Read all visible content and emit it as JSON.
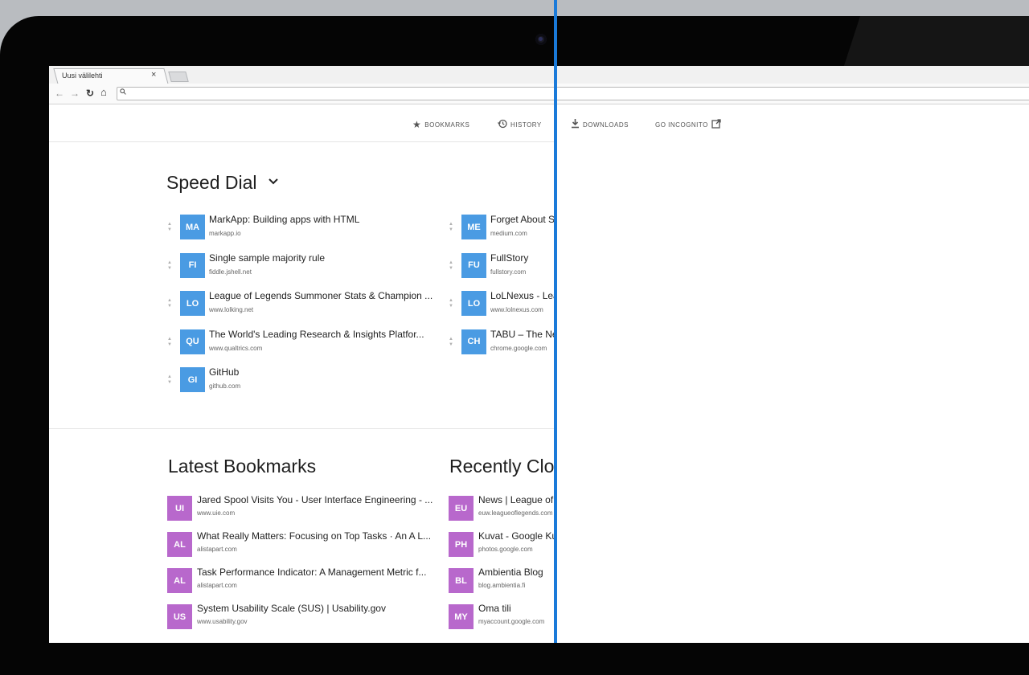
{
  "browser": {
    "tab_title": "Uusi välilehti",
    "tab_close": "×",
    "back_icon": "←",
    "forward_icon": "→",
    "reload_icon": "↻",
    "home_icon": "⌂"
  },
  "topnav": {
    "bookmarks": "BOOKMARKS",
    "history": "HISTORY",
    "downloads": "DOWNLOADS",
    "incognito": "GO INCOGNITO"
  },
  "speed_dial": {
    "title": "Speed Dial",
    "tile_color": "#4a9be3",
    "left": [
      {
        "abbr": "MA",
        "title": "MarkApp: Building apps with HTML",
        "url": "markapp.io"
      },
      {
        "abbr": "FI",
        "title": "Single sample majority rule",
        "url": "fiddle.jshell.net"
      },
      {
        "abbr": "LO",
        "title": "League of Legends Summoner Stats & Champion ...",
        "url": "www.lolking.net"
      },
      {
        "abbr": "QU",
        "title": "The World's Leading Research & Insights Platfor...",
        "url": "www.qualtrics.com"
      },
      {
        "abbr": "GI",
        "title": "GitHub",
        "url": "github.com"
      }
    ],
    "right": [
      {
        "abbr": "ME",
        "title": "Forget About Sc",
        "url": "medium.com"
      },
      {
        "abbr": "FU",
        "title": "FullStory",
        "url": "fullstory.com"
      },
      {
        "abbr": "LO",
        "title": "LoLNexus - Lea",
        "url": "www.lolnexus.com"
      },
      {
        "abbr": "CH",
        "title": "TABU – The Ne",
        "url": "chrome.google.com"
      }
    ]
  },
  "latest_bookmarks": {
    "title": "Latest Bookmarks",
    "tile_color": "#b868cc",
    "items": [
      {
        "abbr": "UI",
        "title": "Jared Spool Visits You - User Interface Engineering - ...",
        "url": "www.uie.com"
      },
      {
        "abbr": "AL",
        "title": "What Really Matters: Focusing on Top Tasks · An A L...",
        "url": "alistapart.com"
      },
      {
        "abbr": "AL",
        "title": "Task Performance Indicator: A Management Metric f...",
        "url": "alistapart.com"
      },
      {
        "abbr": "US",
        "title": "System Usability Scale (SUS) | Usability.gov",
        "url": "www.usability.gov"
      }
    ]
  },
  "recently_closed": {
    "title": "Recently Clo",
    "tile_color": "#b868cc",
    "items": [
      {
        "abbr": "EU",
        "title": "News | League of L",
        "url": "euw.leagueoflegends.com"
      },
      {
        "abbr": "PH",
        "title": "Kuvat - Google Kuv",
        "url": "photos.google.com"
      },
      {
        "abbr": "BL",
        "title": "Ambientia Blog",
        "url": "blog.ambientia.fi"
      },
      {
        "abbr": "MY",
        "title": "Oma tili",
        "url": "myaccount.google.com"
      }
    ]
  },
  "annotation_color": "#1a7ad9"
}
